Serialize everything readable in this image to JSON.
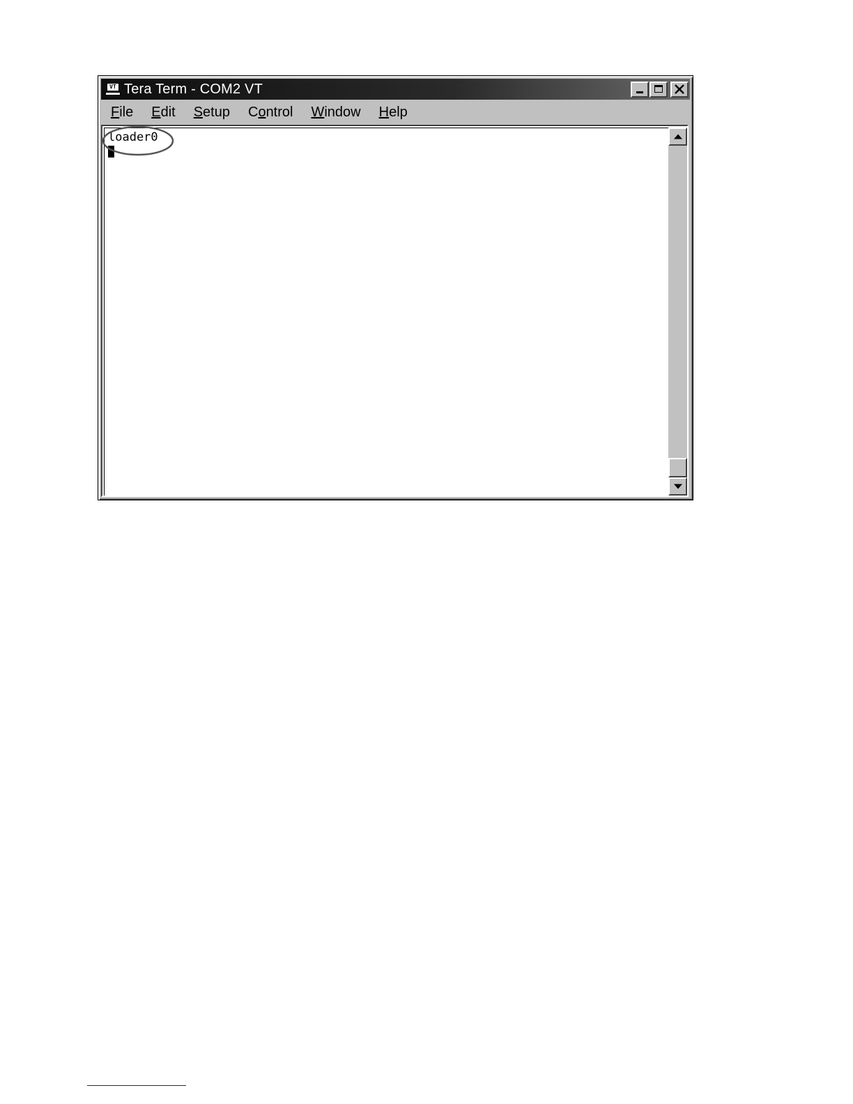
{
  "window": {
    "title": "Tera Term - COM2 VT",
    "app_icon": "terminal-icon",
    "app_icon_text": "VT",
    "controls": [
      "minimize-icon",
      "maximize-icon",
      "close-icon"
    ]
  },
  "menu": {
    "items": [
      {
        "label_underlined": "F",
        "label_rest": "ile",
        "underline_position": 0
      },
      {
        "label_underlined": "E",
        "label_rest": "dit",
        "underline_position": 0
      },
      {
        "label_underlined": "S",
        "label_rest": "etup",
        "underline_position": 0
      },
      {
        "label_pre": "C",
        "label_underlined": "o",
        "label_rest": "ntrol",
        "underline_position": 1
      },
      {
        "label_underlined": "W",
        "label_rest": "indow",
        "underline_position": 0
      },
      {
        "label_underlined": "H",
        "label_rest": "elp",
        "underline_position": 0
      }
    ]
  },
  "terminal": {
    "lines": [
      "loader0"
    ],
    "cursor": "block-cursor"
  },
  "colors": {
    "titlebar": "#0e0e0e",
    "chrome": "#c0c0c0",
    "terminal_bg": "#ffffff",
    "annotation": "#555555",
    "footer_rule": "#1a1aa0"
  }
}
